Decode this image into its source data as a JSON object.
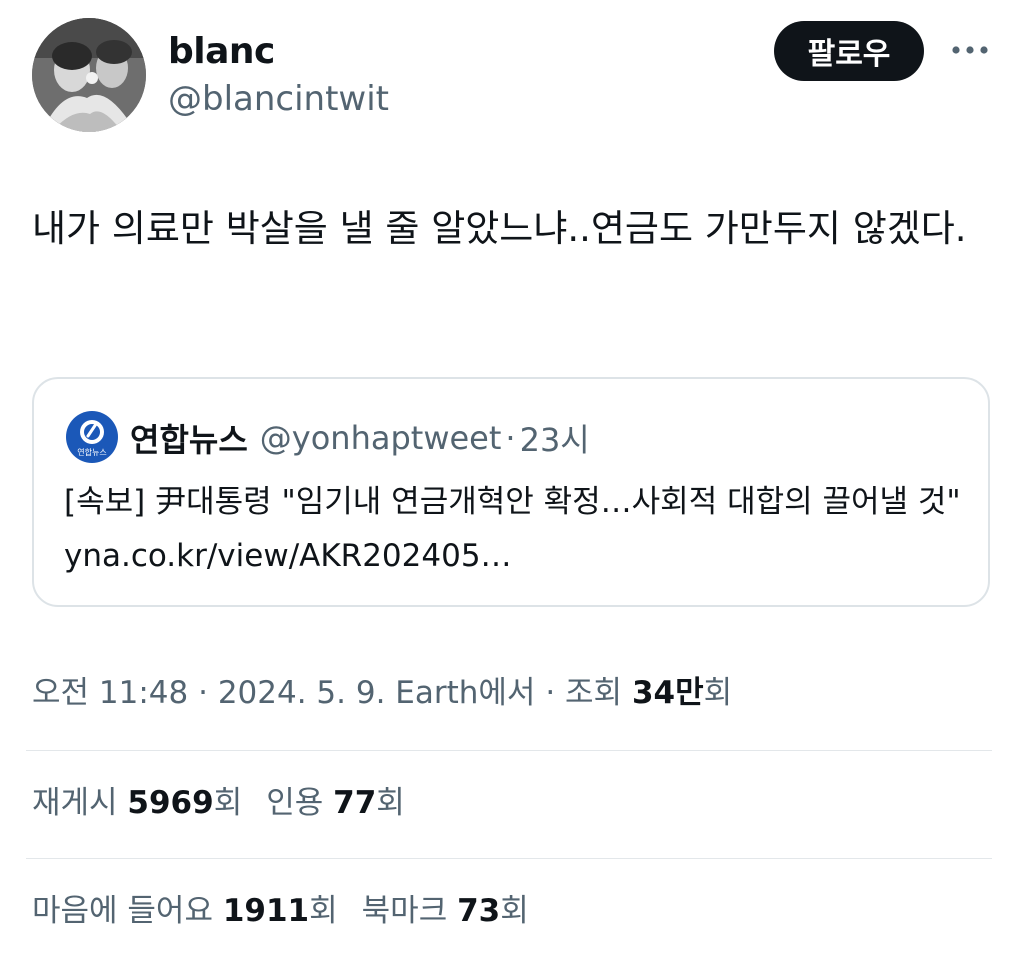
{
  "author": {
    "name": "blanc",
    "handle": "@blancintwit"
  },
  "follow_label": "팔로우",
  "more_icon": "more-dots-icon",
  "post": {
    "text": "내가 의료만 박살을 낼 줄 알았느냐..연금도 가만두지 않겠다."
  },
  "quote": {
    "logo_text": "연합뉴스",
    "name": "연합뉴스",
    "handle": "@yonhaptweet",
    "separator": "·",
    "time": "23시",
    "text": "[속보] 尹대통령 \"임기내 연금개혁안 확정…사회적 대합의 끌어낼 것\" yna.co.kr/view/AKR202405…"
  },
  "meta": {
    "time": "오전 11:48",
    "sep1": "·",
    "date": "2024. 5. 9.",
    "source": "Earth에서",
    "sep2": "·",
    "views_label": "조회",
    "views_value": "34만",
    "views_unit": "회"
  },
  "stats": {
    "reposts_label": "재게시",
    "reposts_value": "5969",
    "reposts_unit": "회",
    "quotes_label": "인용",
    "quotes_value": "77",
    "quotes_unit": "회",
    "likes_label": "마음에 들어요",
    "likes_value": "1911",
    "likes_unit": "회",
    "bookmarks_label": "북마크",
    "bookmarks_value": "73",
    "bookmarks_unit": "회"
  },
  "colors": {
    "text_primary": "#0f1419",
    "text_secondary": "#536471",
    "divider": "#e3e7ea",
    "follow_bg": "#0f1419",
    "yonhap_blue": "#1b58b8"
  }
}
